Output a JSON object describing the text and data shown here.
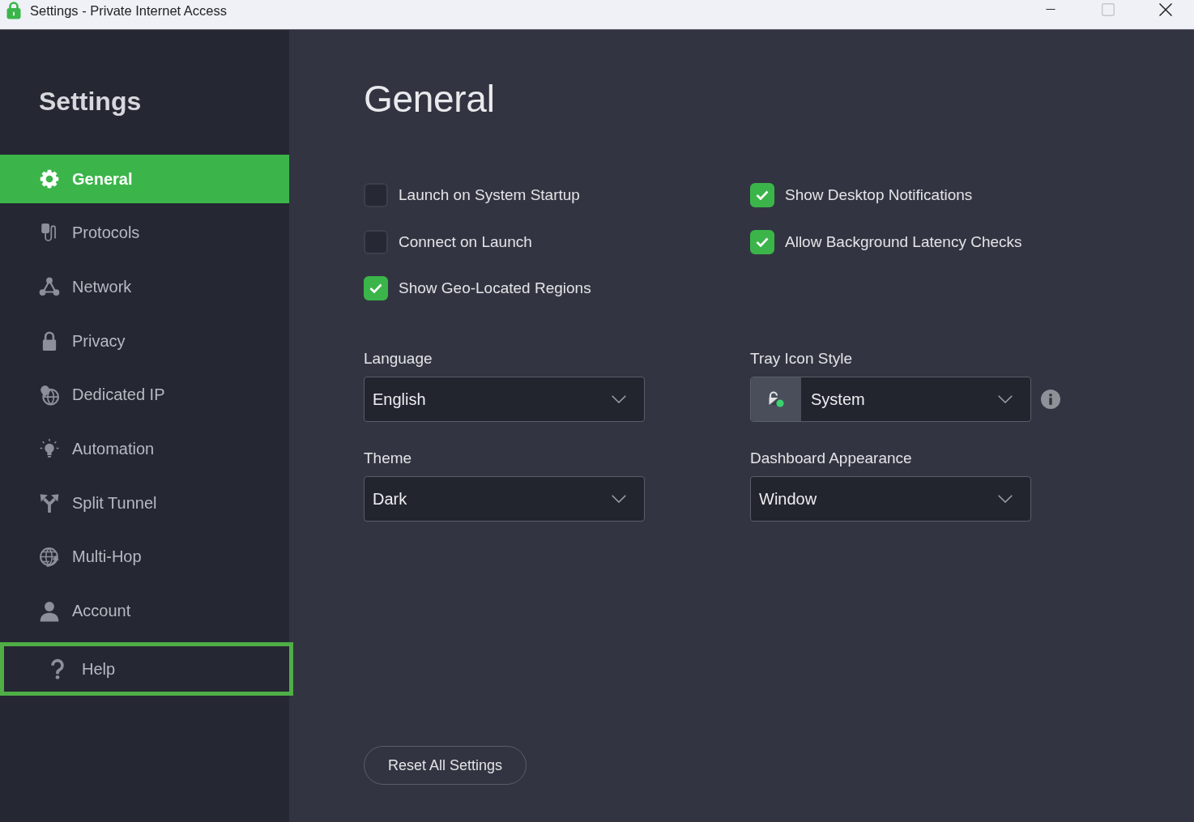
{
  "window": {
    "title": "Settings - Private Internet Access",
    "maximize_disabled": true
  },
  "sidebar": {
    "title": "Settings",
    "items": [
      {
        "label": "General",
        "selected": true,
        "focused": false
      },
      {
        "label": "Protocols",
        "selected": false,
        "focused": false
      },
      {
        "label": "Network",
        "selected": false,
        "focused": false
      },
      {
        "label": "Privacy",
        "selected": false,
        "focused": false
      },
      {
        "label": "Dedicated IP",
        "selected": false,
        "focused": false
      },
      {
        "label": "Automation",
        "selected": false,
        "focused": false
      },
      {
        "label": "Split Tunnel",
        "selected": false,
        "focused": false
      },
      {
        "label": "Multi-Hop",
        "selected": false,
        "focused": false
      },
      {
        "label": "Account",
        "selected": false,
        "focused": false
      },
      {
        "label": "Help",
        "selected": false,
        "focused": true
      }
    ]
  },
  "page": {
    "heading": "General",
    "checkboxes": [
      {
        "label": "Launch on System Startup",
        "checked": false
      },
      {
        "label": "Show Desktop Notifications",
        "checked": true
      },
      {
        "label": "Connect on Launch",
        "checked": false
      },
      {
        "label": "Allow Background Latency Checks",
        "checked": true
      },
      {
        "label": "Show Geo-Located Regions",
        "checked": true
      }
    ],
    "dropdowns": [
      {
        "label": "Language",
        "value": "English",
        "kind": "plain",
        "info_button": false
      },
      {
        "label": "Tray Icon Style",
        "value": "System",
        "kind": "icon",
        "info_button": true
      },
      {
        "label": "Theme",
        "value": "Dark",
        "kind": "plain",
        "info_button": false
      },
      {
        "label": "Dashboard Appearance",
        "value": "Window",
        "kind": "plain",
        "info_button": false
      }
    ],
    "reset_button": "Reset All Settings"
  }
}
